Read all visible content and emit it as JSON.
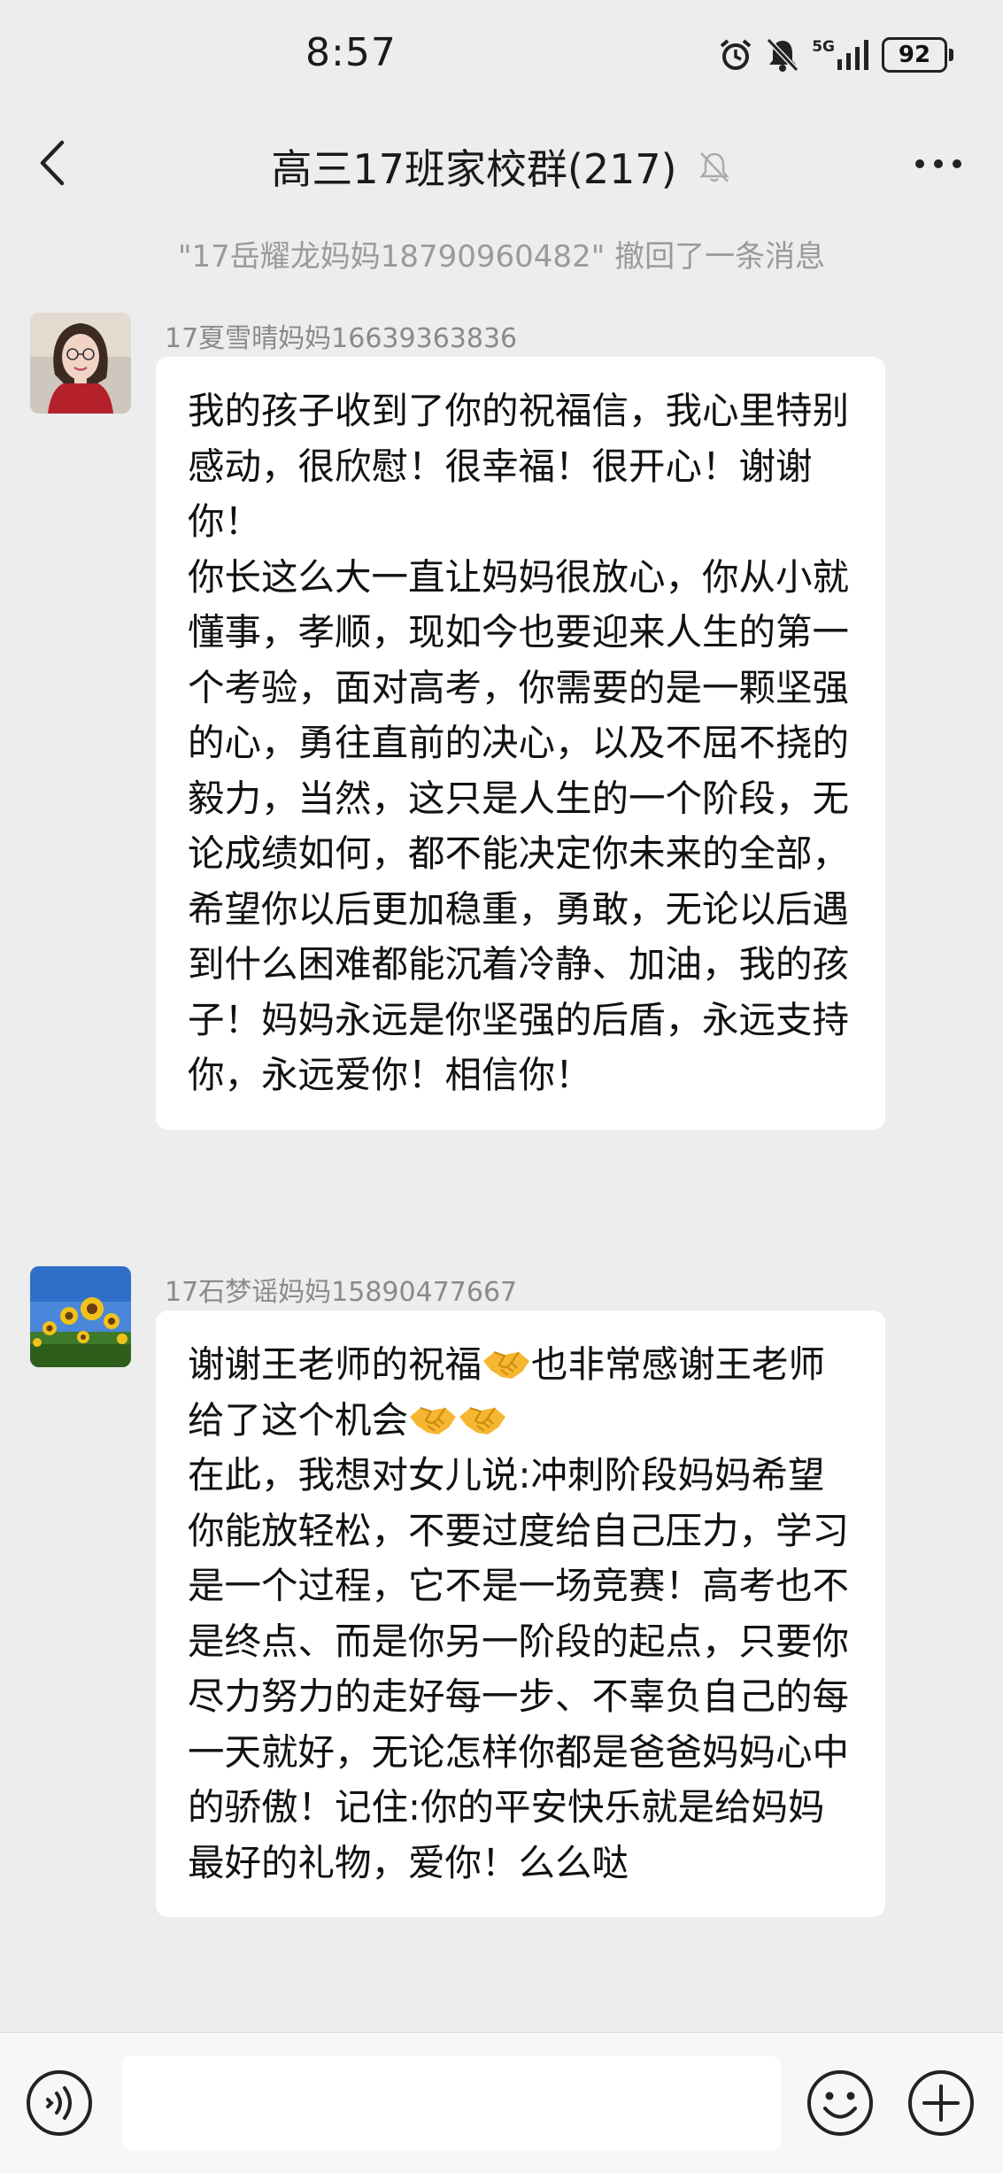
{
  "status_bar": {
    "time": "8:57",
    "network": "5G",
    "battery": "92"
  },
  "nav": {
    "title": "高三17班家校群(217)"
  },
  "notice": {
    "recalled_text": "\"17岳耀龙妈妈18790960482\" 撤回了一条消息"
  },
  "messages": [
    {
      "sender": "17夏雪晴妈妈16639363836",
      "avatar_icon": "woman-portrait-avatar",
      "text": "我的孩子收到了你的祝福信，我心里特别感动，很欣慰！很幸福！很开心！谢谢你！\n你长这么大一直让妈妈很放心，你从小就懂事，孝顺，现如今也要迎来人生的第一个考验，面对高考，你需要的是一颗坚强的心，勇往直前的决心，以及不屈不挠的毅力，当然，这只是人生的一个阶段，无论成绩如何，都不能决定你未来的全部，希望你以后更加稳重，勇敢，无论以后遇到什么困难都能沉着冷静、加油，我的孩子！妈妈永远是你坚强的后盾，永远支持你，永远爱你！相信你！"
    },
    {
      "sender": "17石梦谣妈妈15890477667",
      "avatar_icon": "sunflower-avatar",
      "text_part1": "谢谢王老师的祝福",
      "text_part2": "也非常感谢王老师给了这个机会",
      "text_part3": "\n在此，我想对女儿说:冲刺阶段妈妈希望你能放轻松，不要过度给自己压力，学习是一个过程，它不是一场竞赛！高考也不是终点、而是你另一阶段的起点，只要你尽力努力的走好每一步、不辜负自己的每一天就好，无论怎样你都是爸爸妈妈心中的骄傲！记住:你的平安快乐就是给妈妈最好的礼物，爱你！么么哒"
    }
  ],
  "input": {
    "value": ""
  },
  "colors": {
    "background": "#ededed",
    "bubble": "#ffffff",
    "sender_text": "#8a8a8a"
  }
}
